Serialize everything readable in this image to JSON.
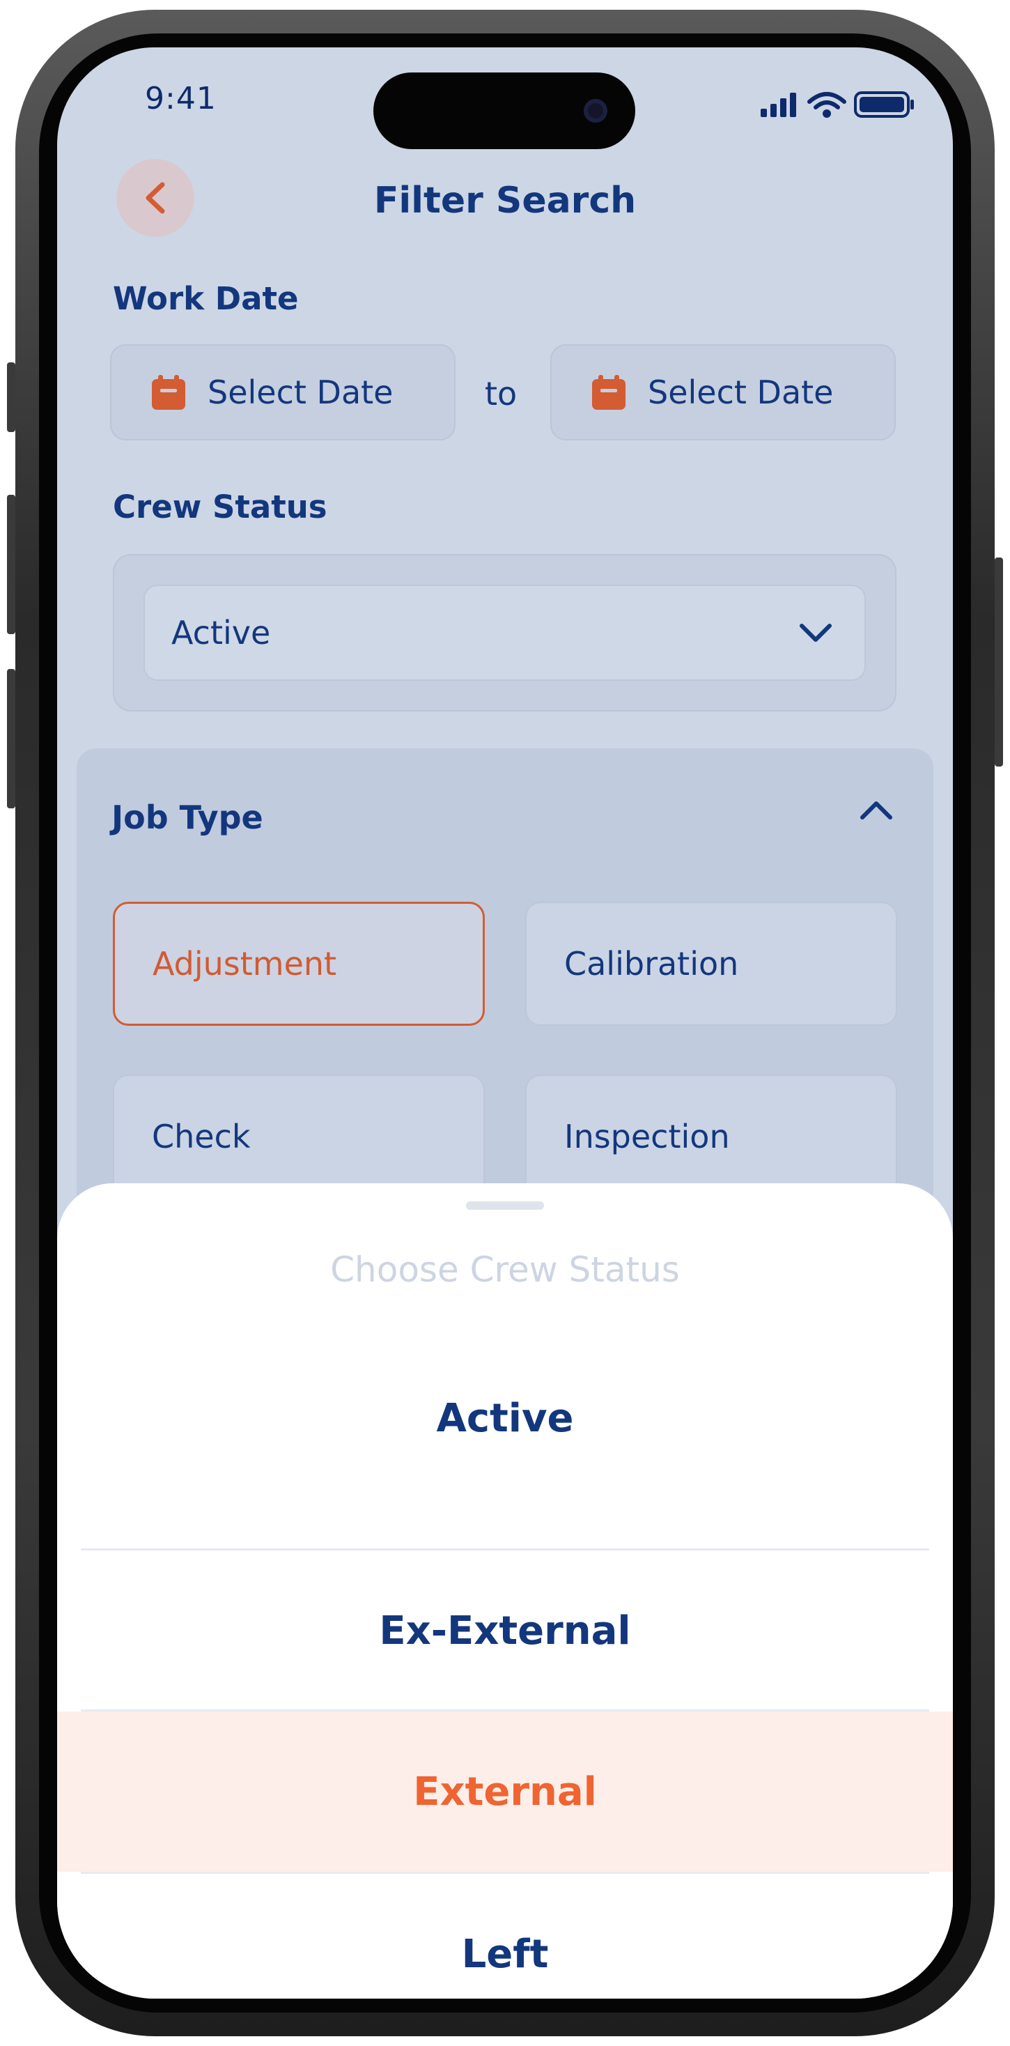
{
  "status_bar": {
    "time": "9:41"
  },
  "header": {
    "title": "Filter Search"
  },
  "work_date": {
    "label": "Work Date",
    "from_placeholder": "Select Date",
    "separator": "to",
    "to_placeholder": "Select Date"
  },
  "crew_status": {
    "label": "Crew Status",
    "selected": "Active"
  },
  "job_type": {
    "label": "Job Type",
    "options": [
      "Adjustment",
      "Calibration",
      "Check",
      "Inspection"
    ],
    "selected": "Adjustment"
  },
  "sheet": {
    "title": "Choose Crew Status",
    "options": [
      "Active",
      "Ex-External",
      "External",
      "Left"
    ],
    "highlighted": "External"
  },
  "colors": {
    "accent": "#ef6431",
    "primary_text": "#13377d",
    "background": "#cdd6e5"
  }
}
